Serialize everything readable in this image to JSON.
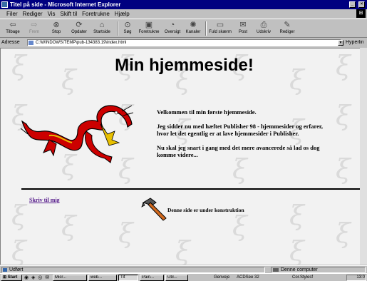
{
  "window": {
    "title": "Titel på side - Microsoft Internet Explorer",
    "controls": {
      "minimize": "_",
      "close": "×"
    }
  },
  "menu": [
    "Filer",
    "Rediger",
    "Vis",
    "Skift til",
    "Foretrukne",
    "Hjælp"
  ],
  "toolbar": {
    "back": "Tilbage",
    "forward": "Frem",
    "stop": "Stop",
    "refresh": "Opdater",
    "home": "Startside",
    "search": "Søg",
    "favorites": "Foretrukne",
    "history": "Oversigt",
    "channels": "Kanaler",
    "fullscreen": "Fuld skærm",
    "mail": "Post",
    "print": "Udskriv",
    "edit": "Rediger"
  },
  "address": {
    "label": "Adresse",
    "value": "C:\\WINDOWS\\TEMP\\pub-134383.19\\index.html",
    "links_label": "Hyperlin"
  },
  "page": {
    "heading": "Min hjemmeside!",
    "intro": [
      "Velkommen til min første hjemmeside.",
      "Jeg sidder nu med hæftet Publisher 98 - hjemmesider og erfarer, hvor let det egentlig er at lave hjemmesider i Publisher.",
      "Nu skal jeg snart i gang med det mere avancerede så lad os dog komme videre..."
    ],
    "mail_link": "Skriv til mig",
    "construction": "Denne side er under konstruktion",
    "colors": {
      "dragon_red": "#cc0000",
      "hammer_orange": "#d2691e",
      "link": "#551a8b"
    }
  },
  "status": {
    "left": "Udført",
    "zone": "Denne computer"
  },
  "taskbar": {
    "start": "Start",
    "items": [
      "Micr...",
      "web...",
      "Tit",
      "Pain...",
      "Util...",
      "Genveje",
      "ACDSee 32",
      "Cor.Stylesf"
    ],
    "clock": "13:0"
  }
}
